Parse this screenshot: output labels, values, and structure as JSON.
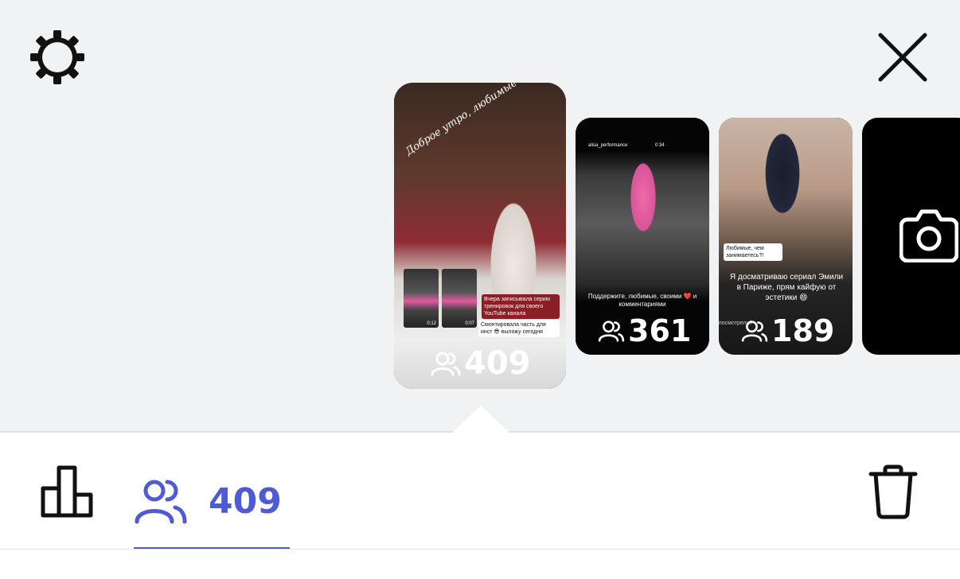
{
  "header": {
    "settings_icon": "gear-icon",
    "close_icon": "close-icon"
  },
  "stories": [
    {
      "selected": true,
      "viewers": "409",
      "script_caption": "Доброе утро, любимые",
      "tag_red": "Вчера записывала серию тренировок для своего YouTube канала",
      "tag_white": "Смонтировала часть для инст 😎 выложу сегодня",
      "thumb_times": [
        "0:12",
        "0:07"
      ]
    },
    {
      "viewers": "361",
      "header_left": "alisa_performance",
      "header_right": "0:34",
      "caption": "Поддержите, любимые, своими ❤️ и комментариями"
    },
    {
      "viewers": "189",
      "tag_white": "Любимые, чем занимаетесь?!",
      "caption": "Я досматриваю сериал Эмили в Париже, прям кайфую от эстетики 😄",
      "faded_caption": "посмотрели?"
    },
    {
      "type": "add-story",
      "icon": "camera-icon"
    }
  ],
  "toolbar": {
    "stats_icon": "bar-chart-icon",
    "viewers_icon": "users-icon",
    "viewers_count": "409",
    "delete_icon": "trash-icon",
    "accent_color": "#4f5bd5"
  }
}
